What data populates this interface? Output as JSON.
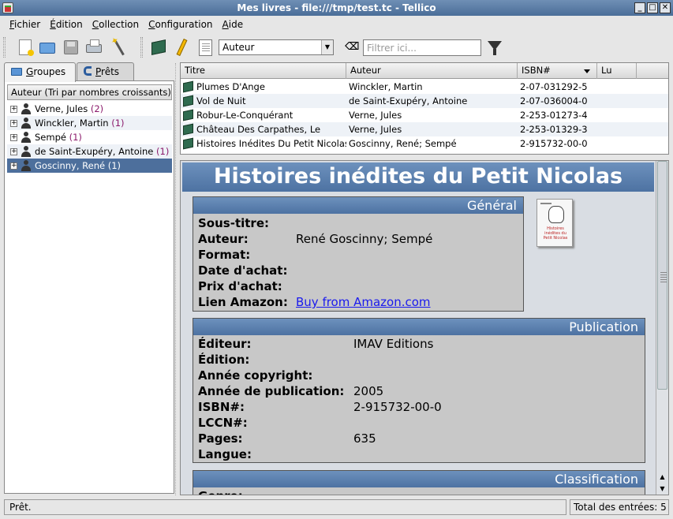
{
  "window": {
    "title": "Mes livres - file:///tmp/test.tc - Tellico",
    "buttons": [
      "_",
      "□",
      "✕"
    ]
  },
  "menubar": {
    "items": [
      {
        "u": "F",
        "rest": "ichier"
      },
      {
        "u": "É",
        "rest": "dition"
      },
      {
        "u": "C",
        "rest": "ollection"
      },
      {
        "u": "C",
        "rest": "onfiguration"
      },
      {
        "u": "A",
        "rest": "ide"
      }
    ]
  },
  "toolbar": {
    "group_field": "Auteur",
    "filter_placeholder": "Filtrer ici..."
  },
  "tabs": [
    {
      "u": "G",
      "rest": "roupes"
    },
    {
      "u": "P",
      "rest": "rêts"
    }
  ],
  "groups": {
    "header": "Auteur (Tri par nombres croissants)",
    "items": [
      {
        "name": "Verne, Jules",
        "count": "(2)"
      },
      {
        "name": "Winckler, Martin",
        "count": "(1)"
      },
      {
        "name": "Sempé",
        "count": "(1)"
      },
      {
        "name": "de Saint-Exupéry, Antoine",
        "count": "(1)"
      },
      {
        "name": "Goscinny, René",
        "count": "(1)"
      }
    ]
  },
  "entries": {
    "columns": [
      "Titre",
      "Auteur",
      "ISBN#",
      "Lu"
    ],
    "rows": [
      {
        "title": "Plumes D'Ange",
        "author": "Winckler, Martin",
        "isbn": "2-07-031292-5"
      },
      {
        "title": "Vol de Nuit",
        "author": "de Saint-Exupéry, Antoine",
        "isbn": "2-07-036004-0"
      },
      {
        "title": "Robur-Le-Conquérant",
        "author": "Verne, Jules",
        "isbn": "2-253-01273-4"
      },
      {
        "title": "Château Des Carpathes, Le",
        "author": "Verne, Jules",
        "isbn": "2-253-01329-3"
      },
      {
        "title": "Histoires Inédites Du Petit Nicolas",
        "author": "Goscinny, René; Sempé",
        "isbn": "2-915732-00-0"
      }
    ]
  },
  "detail": {
    "title": "Histoires inédites du Petit Nicolas",
    "general": {
      "heading": "Général",
      "fields": [
        {
          "label": "Sous-titre:",
          "value": ""
        },
        {
          "label": "Auteur:",
          "value": "René Goscinny; Sempé"
        },
        {
          "label": "Format:",
          "value": ""
        },
        {
          "label": "Date d'achat:",
          "value": ""
        },
        {
          "label": "Prix d'achat:",
          "value": ""
        },
        {
          "label": "Lien Amazon:",
          "value": "Buy from Amazon.com"
        }
      ]
    },
    "cover_text": "Histoires inédites du Petit Nicolas",
    "publication": {
      "heading": "Publication",
      "fields": [
        {
          "label": "Éditeur:",
          "value": "IMAV Editions"
        },
        {
          "label": "Édition:",
          "value": ""
        },
        {
          "label": "Année copyright:",
          "value": ""
        },
        {
          "label": "Année de publication:",
          "value": "2005"
        },
        {
          "label": "ISBN#:",
          "value": "2-915732-00-0"
        },
        {
          "label": "LCCN#:",
          "value": ""
        },
        {
          "label": "Pages:",
          "value": "635"
        },
        {
          "label": "Langue:",
          "value": ""
        }
      ]
    },
    "classification": {
      "heading": "Classification",
      "fields": [
        {
          "label": "Genre:",
          "value": ""
        }
      ]
    }
  },
  "status": {
    "message": "Prêt.",
    "total": "Total des entrées: 5"
  }
}
